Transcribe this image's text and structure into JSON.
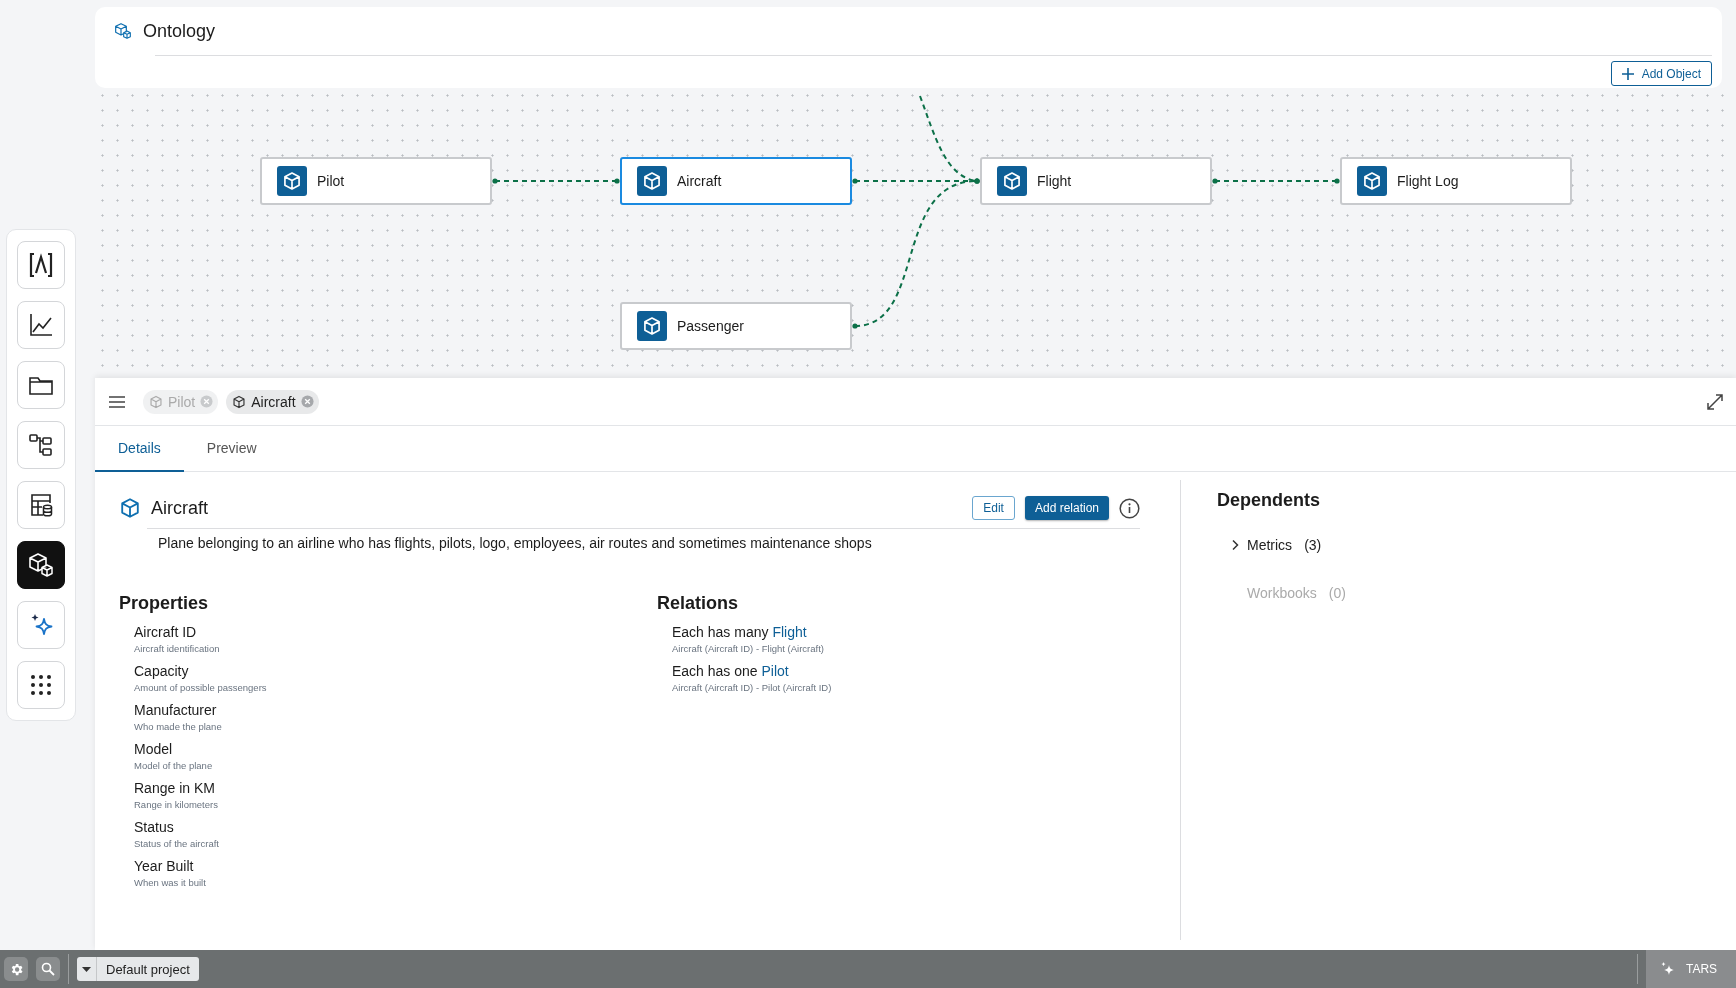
{
  "header": {
    "title": "Ontology",
    "add_button": "Add Object"
  },
  "sidebar": {
    "items": [
      {
        "kind": "lambda",
        "selected": false
      },
      {
        "kind": "chart",
        "selected": false
      },
      {
        "kind": "folder",
        "selected": false
      },
      {
        "kind": "diagram",
        "selected": false
      },
      {
        "kind": "table",
        "selected": false
      },
      {
        "kind": "objects",
        "selected": true
      },
      {
        "kind": "sparkle",
        "selected": false
      },
      {
        "kind": "apps",
        "selected": false
      }
    ]
  },
  "graph": {
    "nodes": [
      {
        "label": "Pilot",
        "selected": false
      },
      {
        "label": "Aircraft",
        "selected": true
      },
      {
        "label": "Flight",
        "selected": false
      },
      {
        "label": "Flight Log",
        "selected": false
      },
      {
        "label": "Passenger",
        "selected": false
      }
    ]
  },
  "panel": {
    "chips": [
      {
        "label": "Pilot",
        "selected": false
      },
      {
        "label": "Aircraft",
        "selected": true
      }
    ],
    "tabs": [
      {
        "label": "Details",
        "selected": true
      },
      {
        "label": "Preview",
        "selected": false
      }
    ],
    "object": {
      "title": "Aircraft",
      "edit_button": "Edit",
      "add_relation_button": "Add relation",
      "description": "Plane belonging to an airline who has flights, pilots, logo, employees, air routes and sometimes maintenance shops"
    },
    "properties": {
      "heading": "Properties",
      "items": [
        {
          "name": "Aircraft ID",
          "description": "Aircraft identification"
        },
        {
          "name": "Capacity",
          "description": "Amount of possible passengers"
        },
        {
          "name": "Manufacturer",
          "description": "Who made the plane"
        },
        {
          "name": "Model",
          "description": "Model of the plane"
        },
        {
          "name": "Range in KM",
          "description": "Range in kilometers"
        },
        {
          "name": "Status",
          "description": "Status of the aircraft"
        },
        {
          "name": "Year Built",
          "description": "When was it built"
        }
      ]
    },
    "relations": {
      "heading": "Relations",
      "items": [
        {
          "prefix": "Each has many",
          "target": "Flight",
          "detail": "Aircraft (Aircraft ID) - Flight (Aircraft)"
        },
        {
          "prefix": "Each has one",
          "target": "Pilot",
          "detail": "Aircraft (Aircraft ID) - Pilot (Aircraft ID)"
        }
      ]
    },
    "dependents": {
      "heading": "Dependents",
      "items": [
        {
          "label": "Metrics",
          "count": "(3)",
          "disabled": false
        },
        {
          "label": "Workbooks",
          "count": "(0)",
          "disabled": true
        }
      ]
    }
  },
  "status_bar": {
    "project": "Default project",
    "assistant": "TARS"
  }
}
